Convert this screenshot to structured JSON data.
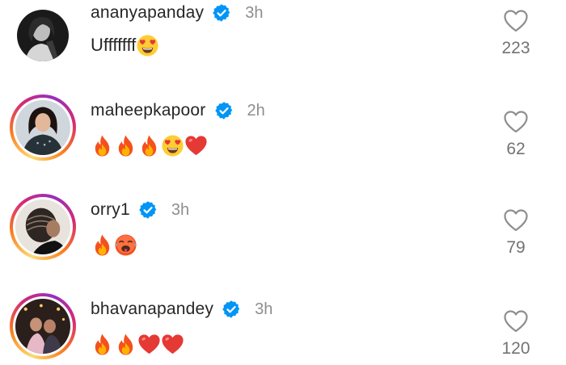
{
  "comments": [
    {
      "username": "ananyapanday",
      "time": "3h",
      "text": "Ufffffff",
      "emojis": [
        "heart-eyes"
      ],
      "likes": "223",
      "story_ring": false
    },
    {
      "username": "maheepkapoor",
      "time": "2h",
      "text": "",
      "emojis": [
        "fire",
        "fire",
        "fire",
        "heart-eyes",
        "red-heart"
      ],
      "likes": "62",
      "story_ring": true
    },
    {
      "username": "orry1",
      "time": "3h",
      "text": "",
      "emojis": [
        "fire",
        "hot-face"
      ],
      "likes": "79",
      "story_ring": true
    },
    {
      "username": "bhavanapandey",
      "time": "3h",
      "text": "",
      "emojis": [
        "fire",
        "fire",
        "red-heart",
        "red-heart"
      ],
      "likes": "120",
      "story_ring": true
    }
  ],
  "colors": {
    "verified_blue": "#0095f6",
    "text_primary": "#262626",
    "text_secondary": "#8e8e8e",
    "story_gradient": [
      "#feda75",
      "#fa7e1e",
      "#d62976",
      "#962fbf"
    ]
  },
  "icons": {
    "verified": "verified-badge-icon",
    "like": "heart-outline-icon"
  }
}
